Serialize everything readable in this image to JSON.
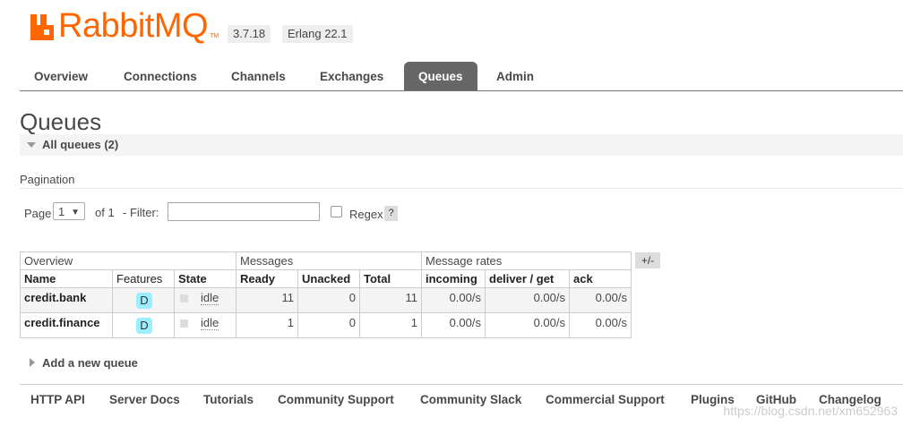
{
  "header": {
    "logo_text": "RabbitMQ",
    "logo_tm": "TM",
    "version": "3.7.18",
    "erlang": "Erlang 22.1",
    "brand_color": "#ff6600"
  },
  "nav": {
    "tabs": [
      {
        "label": "Overview"
      },
      {
        "label": "Connections"
      },
      {
        "label": "Channels"
      },
      {
        "label": "Exchanges"
      },
      {
        "label": "Queues",
        "active": true
      },
      {
        "label": "Admin"
      }
    ]
  },
  "page": {
    "title": "Queues",
    "section_label": "All queues (2)"
  },
  "pagination": {
    "label": "Pagination",
    "page_word": "Page",
    "page_value": "1",
    "of_text": "of 1",
    "filter_label": "- Filter:",
    "filter_value": "",
    "regex_label": "Regex",
    "help_label": "?"
  },
  "table": {
    "groups": [
      "Overview",
      "Messages",
      "Message rates"
    ],
    "columns": [
      "Name",
      "Features",
      "State",
      "Ready",
      "Unacked",
      "Total",
      "incoming",
      "deliver / get",
      "ack"
    ],
    "plus_minus": "+/-",
    "rows": [
      {
        "name": "credit.bank",
        "feature": "D",
        "state": "idle",
        "ready": "11",
        "unacked": "0",
        "total": "11",
        "incoming": "0.00/s",
        "deliver": "0.00/s",
        "ack": "0.00/s"
      },
      {
        "name": "credit.finance",
        "feature": "D",
        "state": "idle",
        "ready": "1",
        "unacked": "0",
        "total": "1",
        "incoming": "0.00/s",
        "deliver": "0.00/s",
        "ack": "0.00/s"
      }
    ]
  },
  "add_queue": "Add a new queue",
  "footer": {
    "links": [
      "HTTP API",
      "Server Docs",
      "Tutorials",
      "Community Support",
      "Community Slack",
      "Commercial Support",
      "Plugins",
      "GitHub",
      "Changelog"
    ]
  },
  "watermark": "https://blog.csdn.net/xm652963"
}
